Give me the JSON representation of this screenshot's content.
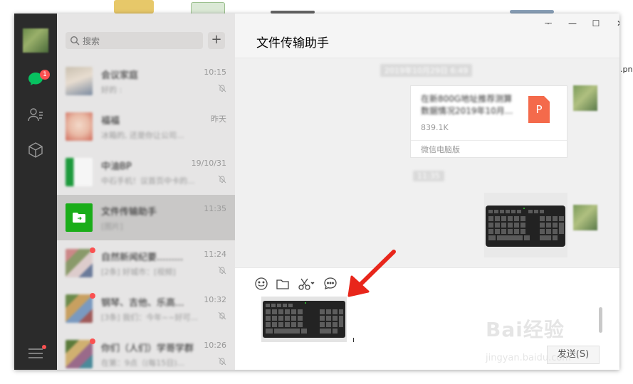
{
  "desktop": {
    "partial_filename": ".png"
  },
  "window_controls": {
    "pin": "ᅮ",
    "minimize": "—",
    "maximize": "☐",
    "close": "✕"
  },
  "sidebar": {
    "chat_badge": "1"
  },
  "search": {
    "placeholder": "搜索",
    "add_label": "+"
  },
  "chats": [
    {
      "name": "会议家庭",
      "preview": "好的 :",
      "time": "10:15",
      "muted": true,
      "unread_dot": false
    },
    {
      "name": "福福",
      "preview": "冰箱的, 还是你让公司...",
      "time": "昨天",
      "muted": false,
      "unread_dot": false
    },
    {
      "name": "中油BP",
      "preview": "中石手机！议首页中卡的...",
      "time": "19/10/31",
      "muted": true,
      "unread_dot": false
    },
    {
      "name": "文件传输助手",
      "preview": "[图片]",
      "time": "11:35",
      "muted": false,
      "unread_dot": false,
      "active": true
    },
    {
      "name": "自然新闻纪要.........",
      "preview": "[2条] 好城市：[视频]",
      "time": "11:24",
      "muted": true,
      "unread_dot": true
    },
    {
      "name": "钢琴、吉他、乐高...",
      "preview": "[3条] 我们：今年~~好可...",
      "time": "10:32",
      "muted": true,
      "unread_dot": true
    },
    {
      "name": "你们（人们）学哥学群",
      "preview": "在第：9点（(每15日)...",
      "time": "10:26",
      "muted": true,
      "unread_dot": true
    }
  ],
  "chat": {
    "title": "文件传输助手",
    "messages": {
      "timestamp1": "2019年10月29日 6:49",
      "file": {
        "name": "在新800G地址推荐测算数据情况2019年10月...",
        "size": "839.1K",
        "icon_letter": "P",
        "source": "微信电脑版"
      },
      "timestamp2": "11:35",
      "image_alt": "keyboard-photo"
    }
  },
  "input": {
    "send_label": "发送(S)"
  },
  "watermark": {
    "text": "Bai经验",
    "sub": "jingyan.baidu.com"
  },
  "colors": {
    "accent_red": "#e8261b",
    "badge_red": "#fa5151",
    "file_red": "#f46a4b",
    "sidebar": "#2b2b2b"
  }
}
